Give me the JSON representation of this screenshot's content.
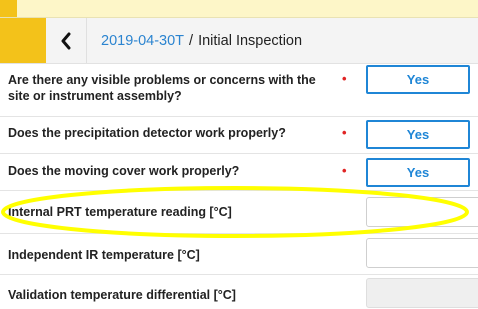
{
  "breadcrumb": {
    "date_link": "2019-04-30T",
    "separator": "/",
    "current": "Initial Inspection"
  },
  "questions": {
    "q1": {
      "label_line1": "Are there any visible problems or concerns with the",
      "label_line2": "site or instrument assembly?",
      "required": "•",
      "answer": "Yes"
    },
    "q2": {
      "label": "Does the precipitation detector work properly?",
      "required": "•",
      "answer": "Yes"
    },
    "q3": {
      "label": "Does the moving cover work properly?",
      "required": "•",
      "answer": "Yes"
    }
  },
  "fields": {
    "prt": {
      "label": "Internal PRT temperature reading [°C]",
      "value": ""
    },
    "ir": {
      "label": "Independent IR temperature [°C]",
      "value": ""
    },
    "diff": {
      "label": "Validation temperature differential [°C]",
      "value": ""
    }
  },
  "colors": {
    "accent_yellow": "#f3c21a",
    "link_blue": "#2b84d0",
    "button_blue": "#1f86d6",
    "required_red": "#e02424",
    "highlight_yellow": "#ffff00"
  },
  "icons": {
    "back": "chevron-left-icon"
  }
}
